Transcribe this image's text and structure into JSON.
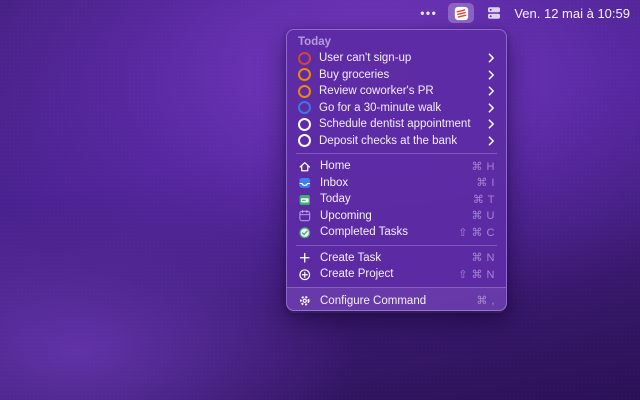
{
  "menu_bar": {
    "overflow_indicator": "•••",
    "app_icon": "todoist",
    "secondary_icon": "stack",
    "clock": "Ven. 12 mai à 10:59"
  },
  "menu": {
    "section_header": "Today",
    "tasks": [
      {
        "label": "User can't sign-up",
        "priority_color": "#d1453b"
      },
      {
        "label": "Buy groceries",
        "priority_color": "#eb8909"
      },
      {
        "label": "Review coworker's PR",
        "priority_color": "#eb8909"
      },
      {
        "label": "Go for a 30-minute walk",
        "priority_color": "#3b78dd"
      },
      {
        "label": "Schedule dentist appointment",
        "priority_color": "#ffffff"
      },
      {
        "label": "Deposit checks at the bank",
        "priority_color": "#ffffff"
      }
    ],
    "nav": [
      {
        "label": "Home",
        "shortcut": "⌘ H",
        "icon": "home"
      },
      {
        "label": "Inbox",
        "shortcut": "⌘ I",
        "icon": "inbox"
      },
      {
        "label": "Today",
        "shortcut": "⌘ T",
        "icon": "calendar-today"
      },
      {
        "label": "Upcoming",
        "shortcut": "⌘ U",
        "icon": "calendar-upcoming"
      },
      {
        "label": "Completed Tasks",
        "shortcut": "⇧ ⌘ C",
        "icon": "check-circle"
      }
    ],
    "actions": [
      {
        "label": "Create Task",
        "shortcut": "⌘ N",
        "icon": "plus"
      },
      {
        "label": "Create Project",
        "shortcut": "⇧ ⌘ N",
        "icon": "plus-circle"
      }
    ],
    "footer": {
      "label": "Configure Command",
      "shortcut": "⌘ ,",
      "icon": "gear"
    }
  },
  "colors": {
    "panel_background": "#5d2ba4",
    "brand_red": "#e44332",
    "priority_red": "#d1453b",
    "priority_orange": "#eb8909",
    "priority_blue": "#3b78dd",
    "inbox_blue": "#3f7df4",
    "today_green": "#3fae72",
    "upcoming_lavender": "#cdbbf5"
  }
}
